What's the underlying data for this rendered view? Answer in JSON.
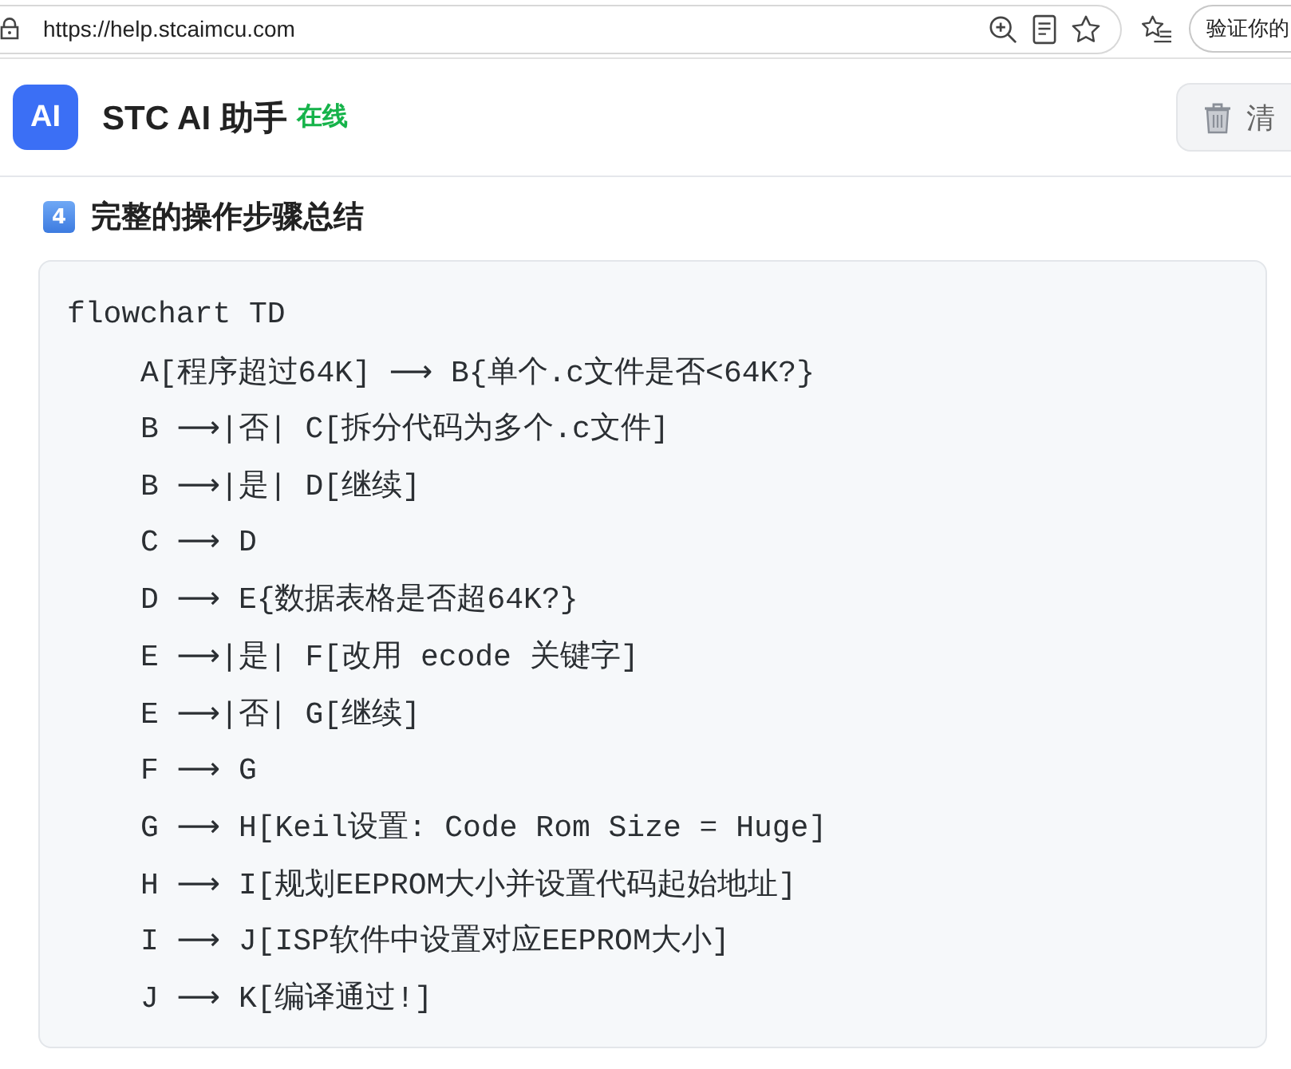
{
  "browser": {
    "url": "https://help.stcaimcu.com",
    "profile_button": "验证你的"
  },
  "header": {
    "logo": "AI",
    "title": "STC AI 助手",
    "status": "在线",
    "clear_button": "清"
  },
  "section": {
    "badge": "4",
    "heading": "完整的操作步骤总结"
  },
  "code": {
    "lines": [
      {
        "text": "flowchart TD",
        "children": [
          {
            "text": "A[程序超过64K] ⟶ B{单个.c文件是否<64K?}"
          },
          {
            "text": "B ⟶|否| C[拆分代码为多个.c文件]"
          },
          {
            "text": "B ⟶|是| D[继续]"
          },
          {
            "text": "C ⟶ D"
          },
          {
            "text": "D ⟶ E{数据表格是否超64K?}"
          },
          {
            "text": "E ⟶|是| F[改用 ecode 关键字]"
          },
          {
            "text": "E ⟶|否| G[继续]"
          },
          {
            "text": "F ⟶ G"
          },
          {
            "text": "G ⟶ H[Keil设置: Code Rom Size = Huge]"
          },
          {
            "text": "H ⟶ I[规划EEPROM大小并设置代码起始地址]"
          },
          {
            "text": "I ⟶ J[ISP软件中设置对应EEPROM大小]"
          },
          {
            "text": "J ⟶ K[编译通过!]"
          }
        ]
      }
    ]
  }
}
